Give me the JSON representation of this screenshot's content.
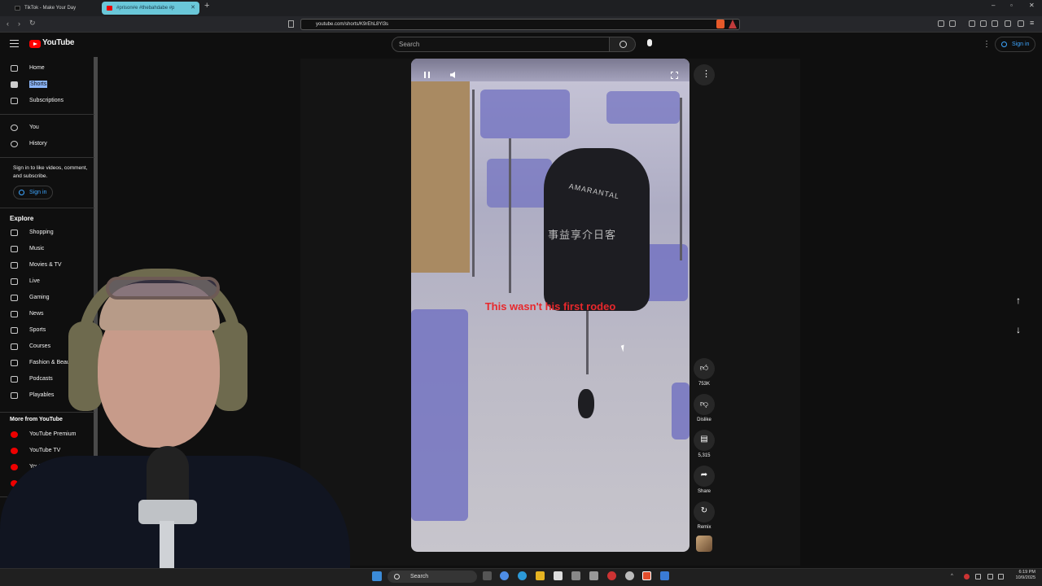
{
  "browser": {
    "tabs": [
      {
        "title": "TikTok - Make Your Day",
        "active": false
      },
      {
        "title": "#prison#e #thebahdabe #p",
        "active": true
      }
    ],
    "new_tab": "+",
    "url": "youtube.com/shorts/K9rEhL8Yl3s"
  },
  "header": {
    "logo_text": "YouTube",
    "search_placeholder": "Search",
    "sign_in": "Sign in"
  },
  "sidebar": {
    "main": [
      {
        "label": "Home",
        "icon": "home-icon"
      },
      {
        "label": "Shorts",
        "icon": "shorts-icon",
        "selected": true
      },
      {
        "label": "Subscriptions",
        "icon": "subscriptions-icon"
      }
    ],
    "you": [
      {
        "label": "You",
        "icon": "account-icon"
      },
      {
        "label": "History",
        "icon": "history-icon"
      }
    ],
    "signin_prompt": "Sign in to like videos, comment, and subscribe.",
    "signin_button": "Sign in",
    "explore_title": "Explore",
    "explore": [
      {
        "label": "Shopping",
        "icon": "shopping-icon"
      },
      {
        "label": "Music",
        "icon": "music-icon"
      },
      {
        "label": "Movies & TV",
        "icon": "movies-icon"
      },
      {
        "label": "Live",
        "icon": "live-icon"
      },
      {
        "label": "Gaming",
        "icon": "gaming-icon"
      },
      {
        "label": "News",
        "icon": "news-icon"
      },
      {
        "label": "Sports",
        "icon": "sports-icon"
      },
      {
        "label": "Courses",
        "icon": "courses-icon"
      },
      {
        "label": "Fashion & Beauty",
        "icon": "fashion-icon"
      },
      {
        "label": "Podcasts",
        "icon": "podcasts-icon"
      },
      {
        "label": "Playables",
        "icon": "playables-icon"
      }
    ],
    "more_title": "More from YouTube",
    "more": [
      {
        "label": "YouTube Premium",
        "icon": "youtube-premium-icon"
      },
      {
        "label": "YouTube TV",
        "icon": "youtube-tv-icon"
      },
      {
        "label": "YouTube Music",
        "icon": "youtube-music-icon"
      },
      {
        "label": "YouTube Kids",
        "icon": "youtube-kids-icon"
      }
    ]
  },
  "video": {
    "caption": "This wasn't his first rodeo",
    "jacket_text": "AMARANTAL",
    "jacket_text_cn": "事益享介日客"
  },
  "actions": {
    "like_count": "753K",
    "dislike_label": "Dislike",
    "comments_count": "5,315",
    "share_label": "Share",
    "remix_label": "Remix"
  },
  "taskbar": {
    "search": "Search",
    "time": "6:19 PM",
    "date": "10/9/2025"
  },
  "colors": {
    "youtube_red": "#ff0000",
    "caption_red": "#e8282c",
    "link_blue": "#3ea6ff"
  }
}
